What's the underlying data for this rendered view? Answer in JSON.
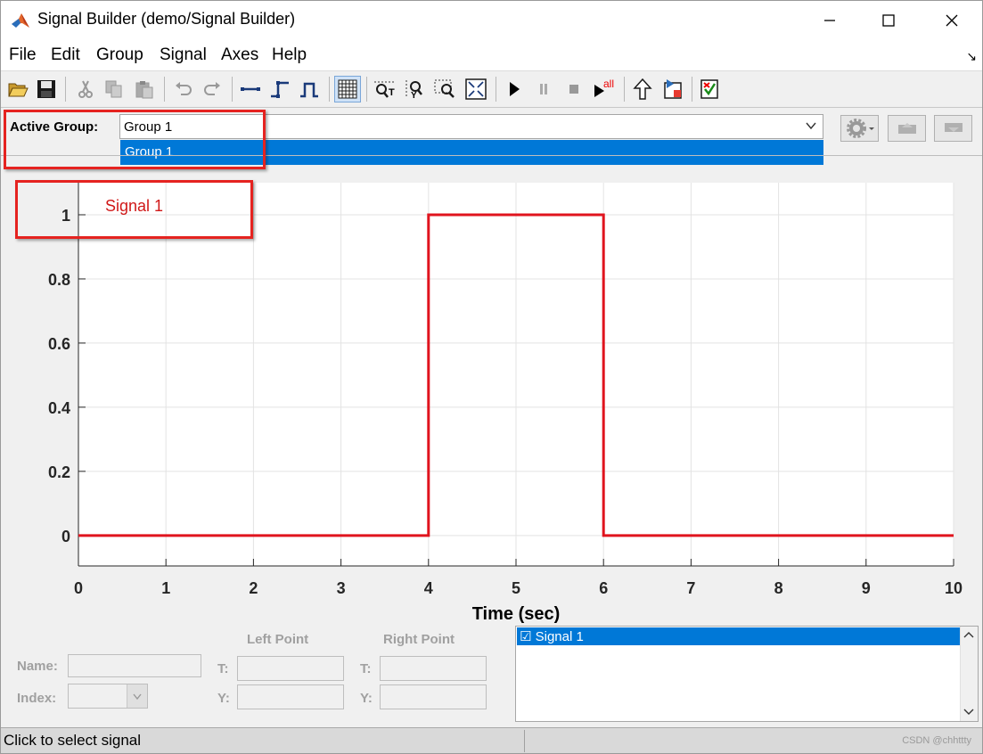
{
  "window": {
    "title": "Signal Builder (demo/Signal Builder)",
    "controls": {
      "minimize": "—",
      "maximize": "☐",
      "close": "✕"
    }
  },
  "menu": [
    "File",
    "Edit",
    "Group",
    "Signal",
    "Axes",
    "Help"
  ],
  "menu_arrow": "↘",
  "toolbar": [
    {
      "name": "open-icon"
    },
    {
      "name": "save-icon"
    },
    {
      "name": "cut-icon"
    },
    {
      "name": "copy-icon"
    },
    {
      "name": "paste-icon"
    },
    {
      "name": "undo-icon"
    },
    {
      "name": "redo-icon"
    },
    {
      "name": "line-segment-icon"
    },
    {
      "name": "step-icon"
    },
    {
      "name": "pulse-icon"
    },
    {
      "name": "grid-icon"
    },
    {
      "name": "zoom-t-icon"
    },
    {
      "name": "zoom-y-icon"
    },
    {
      "name": "zoom-box-icon"
    },
    {
      "name": "fit-view-icon"
    },
    {
      "name": "play-icon"
    },
    {
      "name": "pause-icon"
    },
    {
      "name": "stop-icon"
    },
    {
      "name": "run-all-icon",
      "badge": "all"
    },
    {
      "name": "up-arrow-icon"
    },
    {
      "name": "goto-block-icon"
    },
    {
      "name": "verification-icon"
    }
  ],
  "group": {
    "label": "Active Group:",
    "selected": "Group 1",
    "options": [
      "Group 1"
    ]
  },
  "signal_label": "Signal 1",
  "chart_data": {
    "type": "line",
    "xlabel": "Time (sec)",
    "ylabel": "",
    "xlim": [
      0,
      10
    ],
    "ylim": [
      -0.095,
      1.1
    ],
    "xticks": [
      0,
      1,
      2,
      3,
      4,
      5,
      6,
      7,
      8,
      9,
      10
    ],
    "yticks": [
      0,
      0.2,
      0.4,
      0.6,
      0.8,
      1
    ],
    "ytick_labels": [
      "0",
      "0.2",
      "0.4",
      "0.6",
      "0.8",
      "1"
    ],
    "grid": true,
    "series": [
      {
        "name": "Signal 1",
        "color": "#e0141e",
        "x": [
          0,
          4,
          4,
          6,
          6,
          10
        ],
        "y": [
          0,
          0,
          1,
          1,
          0,
          0
        ]
      }
    ]
  },
  "editor": {
    "name_label": "Name:",
    "index_label": "Index:",
    "left_point": "Left Point",
    "right_point": "Right Point",
    "t_label": "T:",
    "y_label": "Y:"
  },
  "signals": [
    "☑ Signal 1"
  ],
  "status": {
    "text": "Click to select signal",
    "watermark": "CSDN @chhttty"
  }
}
